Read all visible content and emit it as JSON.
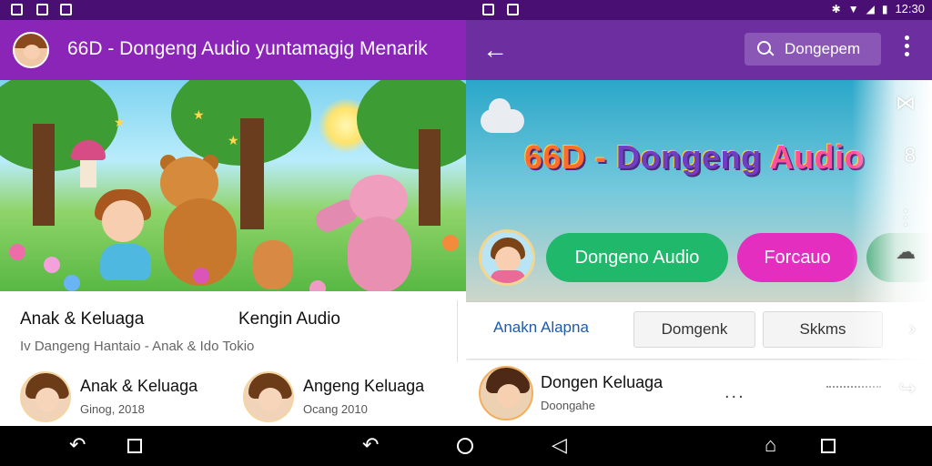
{
  "statusbar": {
    "time": "12:30",
    "icons": [
      "image-icon",
      "image-icon",
      "image-icon",
      "image-icon",
      "image-icon",
      "bluetooth-icon",
      "wifi-icon",
      "signal-icon",
      "battery-icon"
    ]
  },
  "left_panel": {
    "appbar": {
      "title": "66D - Dongeng Audio yuntamagig Menarik"
    },
    "info": {
      "tag_a": "Anak & Keluaga",
      "tag_b": "Kengin Audio",
      "subtitle": "Iv Dangeng Hantaio - Anak & Ido Tokio",
      "items": [
        {
          "title": "Anak & Keluaga",
          "meta": "Ginog, 2018"
        },
        {
          "title": "Angeng Keluaga",
          "meta": "Ocang 2010"
        }
      ]
    }
  },
  "right_panel": {
    "appbar": {
      "search_text": "Dongepem"
    },
    "hero": {
      "logo_part1": "66D - ",
      "logo_part2": "Dongeng ",
      "logo_part3": "Audio",
      "pills": [
        "Dongeno Audio",
        "Forcauo",
        ""
      ]
    },
    "tabs": {
      "tab1": "Anakn Alapna",
      "tab2": "Domgenk",
      "tab3": "Skkms"
    },
    "track": {
      "title": "Dongen Keluaga",
      "meta": "Doongahe",
      "dots": "..."
    }
  },
  "colors": {
    "appbar_left": "#8a25b8",
    "appbar_right": "#6d2fa0",
    "green_pill": "#20b86a",
    "pink_pill": "#e32ec0",
    "tab_active": "#1f5aa8"
  },
  "icons": {
    "search": "search-icon",
    "back": "arrow-left-icon",
    "more": "more-vert-icon",
    "navigation": [
      "back-icon",
      "square-icon",
      "back-icon",
      "circle-icon",
      "back-icon",
      "home-icon",
      "square-icon"
    ]
  }
}
